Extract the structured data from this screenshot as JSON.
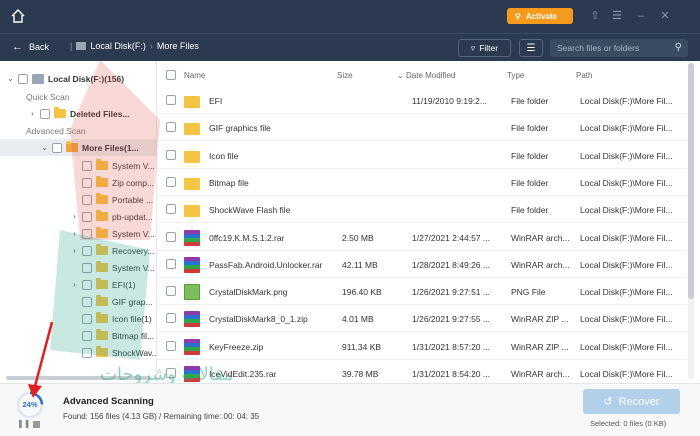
{
  "titlebar": {
    "activate_label": "Activate",
    "icons": [
      "home-icon",
      "key-icon",
      "upload-icon",
      "menu-icon",
      "minimize-icon",
      "close-icon"
    ]
  },
  "nav": {
    "back_label": "Back",
    "path": [
      "Local Disk(F:)",
      "More Files"
    ],
    "filter_label": "Filter",
    "search_placeholder": "Search files or folders"
  },
  "tree": {
    "root": "Local Disk(F:)(156)",
    "quick_scan_label": "Quick Scan",
    "deleted_files": "Deleted Files...",
    "advanced_scan_label": "Advanced Scan",
    "more_files": "More Files(1...",
    "items": [
      "System V...",
      "Zip comp...",
      "Portable ...",
      "pb-updat...",
      "System V...",
      "Recovery...",
      "System V...",
      "EFI(1)",
      "GIF grap...",
      "Icon file(1)",
      "Bitmap fil...",
      "ShockWav..."
    ]
  },
  "list": {
    "columns": [
      "Name",
      "Size",
      "Date Modified",
      "Type",
      "Path"
    ],
    "rows": [
      {
        "name": "EFI",
        "size": "",
        "date": "11/19/2010 9:19:2...",
        "type": "File folder",
        "path": "Local Disk(F:)\\More Fil...",
        "icon": "folder"
      },
      {
        "name": "GIF graphics file",
        "size": "",
        "date": "",
        "type": "File folder",
        "path": "Local Disk(F:)\\More Fil...",
        "icon": "folder"
      },
      {
        "name": "Icon file",
        "size": "",
        "date": "",
        "type": "File folder",
        "path": "Local Disk(F:)\\More Fil...",
        "icon": "folder"
      },
      {
        "name": "Bitmap file",
        "size": "",
        "date": "",
        "type": "File folder",
        "path": "Local Disk(F:)\\More Fil...",
        "icon": "folder"
      },
      {
        "name": "ShockWave Flash file",
        "size": "",
        "date": "",
        "type": "File folder",
        "path": "Local Disk(F:)\\More Fil...",
        "icon": "folder"
      },
      {
        "name": "0ffc19.K.M.S.1.2.rar",
        "size": "2.50 MB",
        "date": "1/27/2021 2:44:57 ...",
        "type": "WinRAR arch...",
        "path": "Local Disk(F:)\\More Fil...",
        "icon": "rar"
      },
      {
        "name": "PassFab.Android.Unlocker.rar",
        "size": "42.11 MB",
        "date": "1/28/2021 8:49:26 ...",
        "type": "WinRAR arch...",
        "path": "Local Disk(F:)\\More Fil...",
        "icon": "rar"
      },
      {
        "name": "CrystalDiskMark.png",
        "size": "196.40 KB",
        "date": "1/26/2021 9:27:51 ...",
        "type": "PNG File",
        "path": "Local Disk(F:)\\More Fil...",
        "icon": "png"
      },
      {
        "name": "CrystalDiskMark8_0_1.zip",
        "size": "4.01 MB",
        "date": "1/26/2021 9:27:55 ...",
        "type": "WinRAR ZIP ...",
        "path": "Local Disk(F:)\\More Fil...",
        "icon": "rar"
      },
      {
        "name": "KeyFreeze.zip",
        "size": "911.34 KB",
        "date": "1/31/2021 8:57:20 ...",
        "type": "WinRAR ZIP ...",
        "path": "Local Disk(F:)\\More Fil...",
        "icon": "rar"
      },
      {
        "name": "IceVidEdit.235.rar",
        "size": "39.78 MB",
        "date": "1/31/2021 8:54:20 ...",
        "type": "WinRAR arch...",
        "path": "Local Disk(F:)\\More Fil...",
        "icon": "rar"
      }
    ]
  },
  "bottom": {
    "progress_percent": 24,
    "progress_label": "24%",
    "scan_title": "Advanced Scanning",
    "scan_status": "Found: 156 files (4.13 GB) / Remaining time: 00: 04: 35",
    "recover_label": "Recover",
    "selected_text": "Selected: 0 files (0 KB)"
  },
  "watermark": {
    "text": "مقالات وشروحات"
  },
  "colors": {
    "header_bg": "#2b3a4f",
    "accent_orange": "#f59a1b",
    "folder_yellow": "#f6c445",
    "progress_blue": "#2b6fd1",
    "recover_disabled": "#b3d0ea"
  }
}
